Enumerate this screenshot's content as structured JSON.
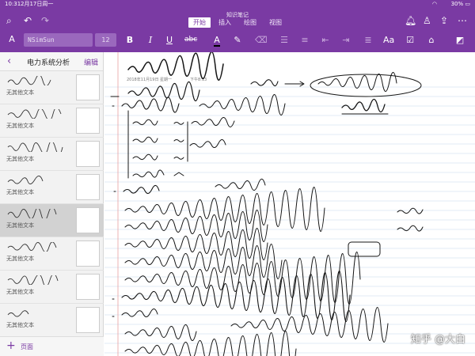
{
  "status_bar": {
    "time": "10:31",
    "date": "2月17日周一",
    "battery": "30%"
  },
  "app": {
    "title": "知识笔记"
  },
  "ribbon_tabs": [
    {
      "label": "开始",
      "active": true
    },
    {
      "label": "插入",
      "active": false
    },
    {
      "label": "绘图",
      "active": false
    },
    {
      "label": "视图",
      "active": false
    }
  ],
  "toolbar": {
    "font_name": "NSimSun",
    "font_size": "12"
  },
  "sidebar": {
    "section_title": "电力系统分析",
    "edit_label": "编辑",
    "add_page_label": "页面",
    "pages": [
      {
        "subtitle": "无其他文本",
        "selected": false
      },
      {
        "subtitle": "无其他文本",
        "selected": false
      },
      {
        "subtitle": "无其他文本",
        "selected": false
      },
      {
        "subtitle": "无其他文本",
        "selected": false
      },
      {
        "subtitle": "无其他文本",
        "selected": true
      },
      {
        "subtitle": "无其他文本",
        "selected": false
      },
      {
        "subtitle": "无其他文本",
        "selected": false
      },
      {
        "subtitle": "无其他文本",
        "selected": false
      }
    ]
  },
  "note": {
    "date": "2018年11月19日 星期一",
    "time": "下午8:13",
    "watermark": "知乎 @大白"
  },
  "colors": {
    "accent": "#7a3aa3",
    "sidebar_bg": "#f2f2f2",
    "selected_row": "#d2d2d2"
  }
}
